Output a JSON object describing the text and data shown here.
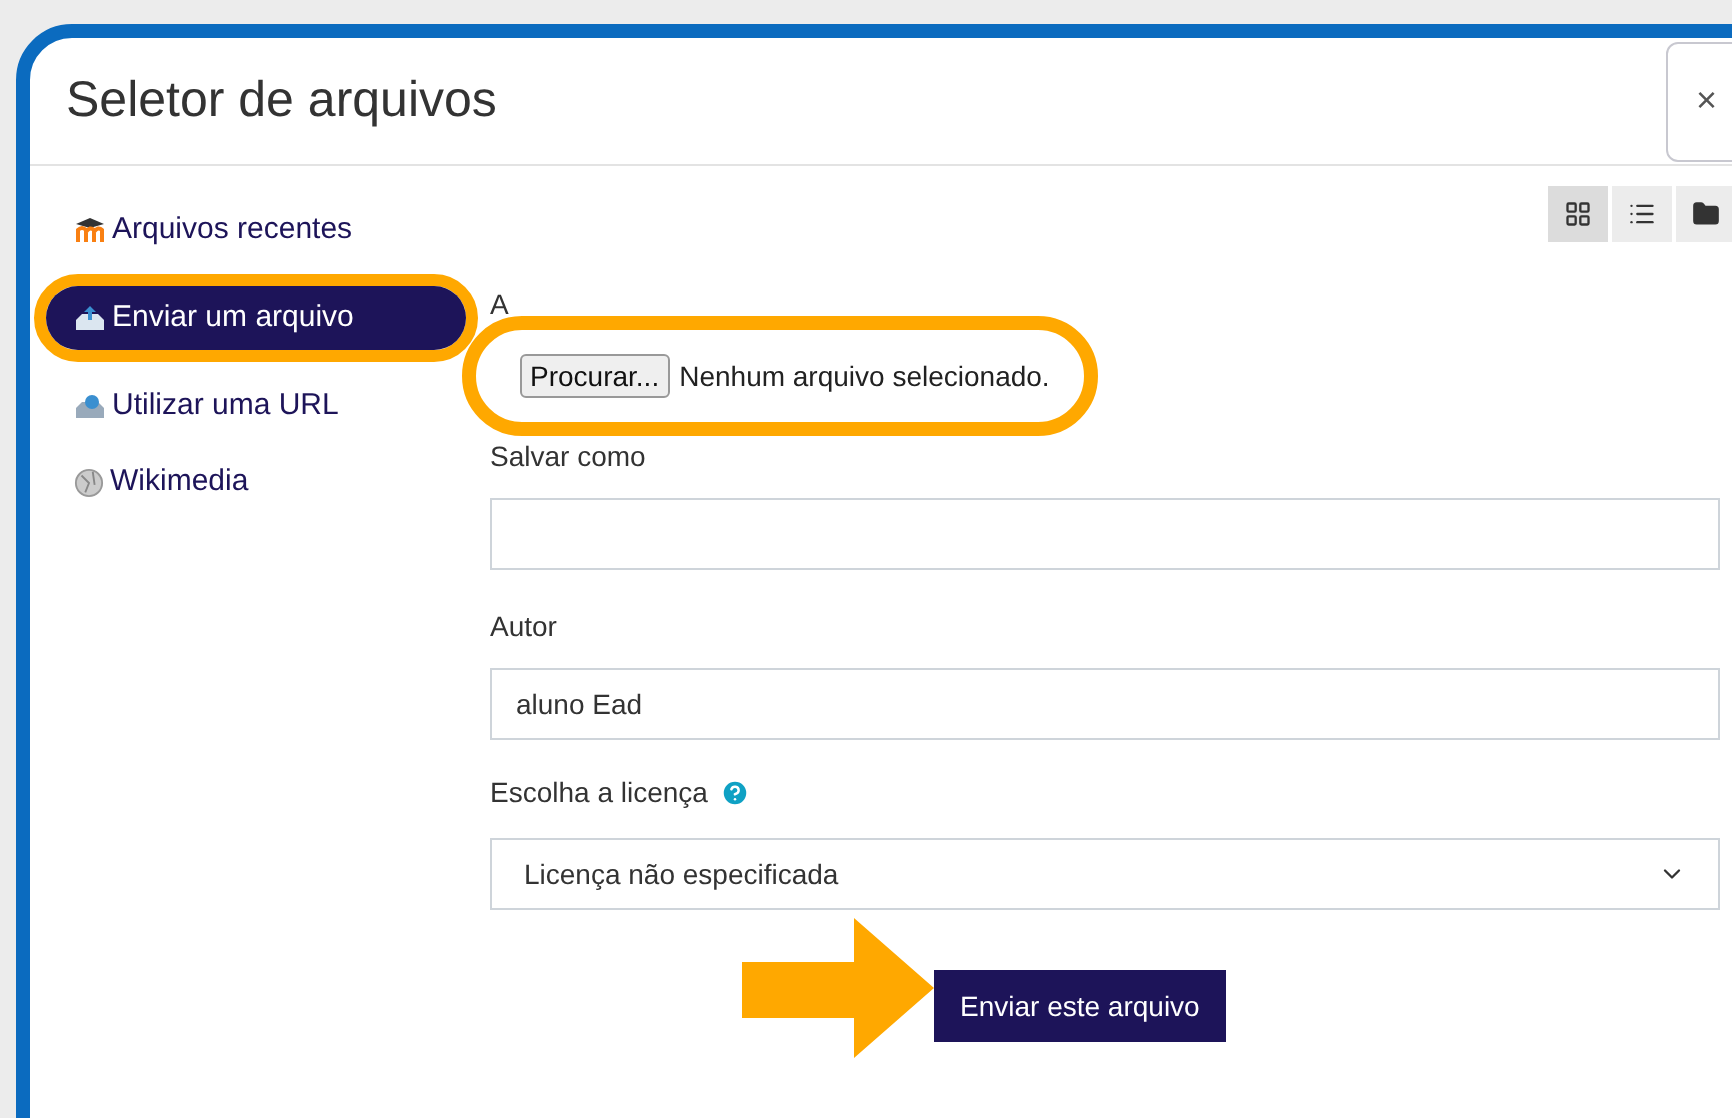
{
  "window": {
    "title": "Seletor de arquivos",
    "close": "×"
  },
  "sidebar": {
    "items": [
      {
        "label": "Arquivos recentes",
        "kind": "recent",
        "selected": false,
        "highlighted": false
      },
      {
        "label": "Enviar um arquivo",
        "kind": "upload",
        "selected": true,
        "highlighted": true
      },
      {
        "label": "Utilizar uma URL",
        "kind": "url",
        "selected": false,
        "highlighted": false
      },
      {
        "label": "Wikimedia",
        "kind": "wiki",
        "selected": false,
        "highlighted": false
      }
    ]
  },
  "view_buttons": [
    {
      "kind": "grid",
      "selected": true
    },
    {
      "kind": "list",
      "selected": false
    },
    {
      "kind": "tree",
      "selected": false
    }
  ],
  "form": {
    "attachment_label": "A",
    "browse_button": "Procurar...",
    "no_file": "Nenhum arquivo selecionado.",
    "file_highlighted": true,
    "save_as": {
      "label": "Salvar como"
    },
    "author": {
      "label": "Autor",
      "value": "aluno Ead"
    },
    "license": {
      "label": "Escolha a licença",
      "value": "Licença não especificada"
    },
    "submit": "Enviar este arquivo",
    "submit_arrow": true
  }
}
